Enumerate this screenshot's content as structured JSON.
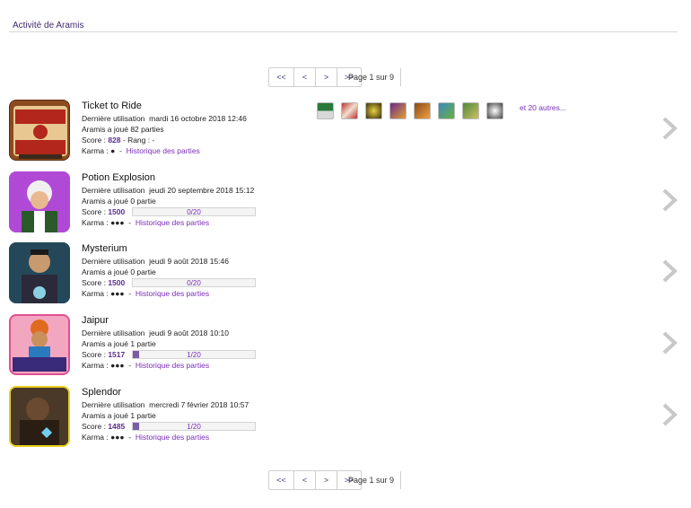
{
  "section": {
    "title": "Activité de Aramis"
  },
  "pagination": {
    "first": "<<",
    "prev": "<",
    "info": "Page 1 sur 9",
    "next": ">",
    "last": ">>"
  },
  "labels": {
    "last_used": "Dernière utilisation",
    "score": "Score :",
    "rank": "- Rang : -",
    "karma": "Karma :",
    "history": "Historique des parties",
    "dash": "-"
  },
  "colors": {
    "accent": "#7a2db8",
    "title": "#3f2a6b",
    "bar_fill": "#7a5ca8",
    "chevron": "#c8c8c8"
  },
  "games": [
    {
      "name": "Ticket to Ride",
      "last_used": "mardi 16 octobre 2018 12:46",
      "played": "Aramis a joué 82 parties",
      "score": "828",
      "karma": "●",
      "has_rank": true,
      "icon": "ticket-to-ride-icon",
      "expansions": {
        "icons": [
          "expansion-map-icon-1",
          "expansion-map-icon-2",
          "expansion-map-icon-3",
          "expansion-map-icon-4",
          "expansion-map-icon-5",
          "expansion-map-icon-6",
          "expansion-map-icon-7",
          "expansion-map-icon-8"
        ],
        "more": "et 20 autres..."
      }
    },
    {
      "name": "Potion Explosion",
      "last_used": "jeudi 20 septembre 2018 15:12",
      "played": "Aramis a joué 0 partie",
      "score": "1500",
      "karma": "●●●",
      "progress_text": "0/20",
      "progress": 0,
      "icon": "potion-explosion-icon"
    },
    {
      "name": "Mysterium",
      "last_used": "jeudi 9 août 2018 15:46",
      "played": "Aramis a joué 0 partie",
      "score": "1500",
      "karma": "●●●",
      "progress_text": "0/20",
      "progress": 0,
      "icon": "mysterium-icon"
    },
    {
      "name": "Jaipur",
      "last_used": "jeudi 9 août 2018 10:10",
      "played": "Aramis a joué 1 partie",
      "score": "1517",
      "karma": "●●●",
      "progress_text": "1/20",
      "progress": 0.05,
      "icon": "jaipur-icon"
    },
    {
      "name": "Splendor",
      "last_used": "mercredi 7 février 2018 10:57",
      "played": "Aramis a joué 1 partie",
      "score": "1485",
      "karma": "●●●",
      "progress_text": "1/20",
      "progress": 0.05,
      "icon": "splendor-icon"
    }
  ]
}
